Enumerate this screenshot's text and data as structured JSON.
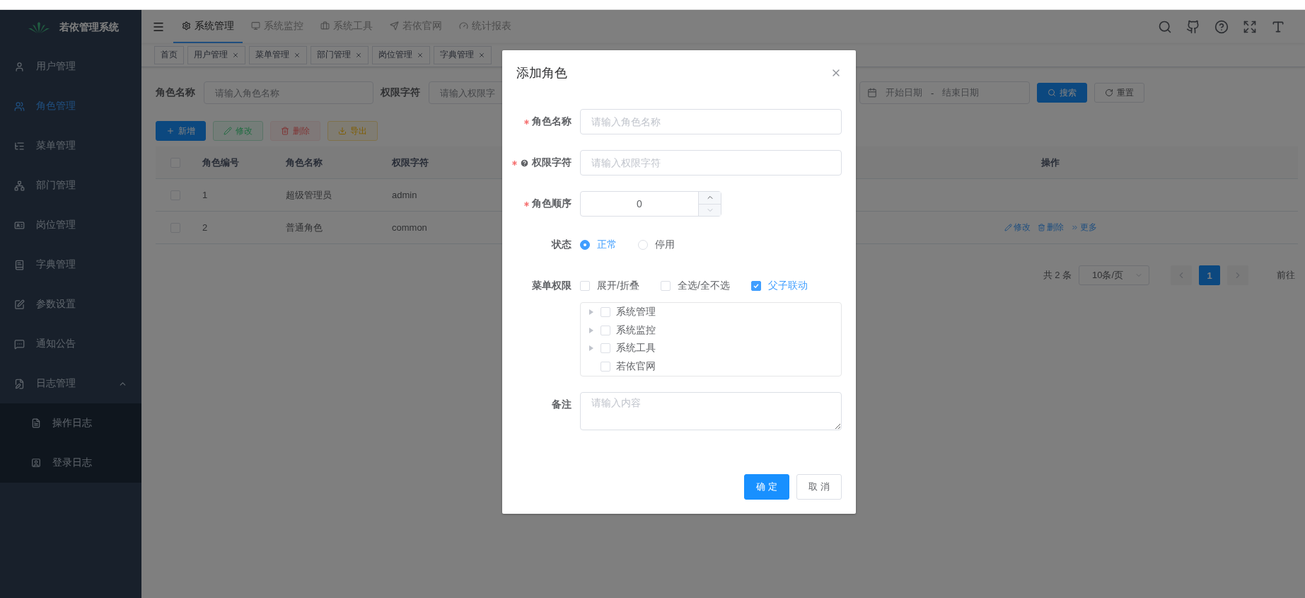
{
  "sidebar": {
    "title": "若依管理系统",
    "items": [
      {
        "label": "用户管理",
        "selected": false
      },
      {
        "label": "角色管理",
        "selected": true
      },
      {
        "label": "菜单管理",
        "selected": false
      },
      {
        "label": "部门管理",
        "selected": false
      },
      {
        "label": "岗位管理",
        "selected": false
      },
      {
        "label": "字典管理",
        "selected": false
      },
      {
        "label": "参数设置",
        "selected": false
      },
      {
        "label": "通知公告",
        "selected": false
      },
      {
        "label": "日志管理",
        "selected": false,
        "expanded": true,
        "children": [
          {
            "label": "操作日志",
            "selected": false
          },
          {
            "label": "登录日志",
            "selected": false
          }
        ]
      }
    ]
  },
  "topnav": {
    "tabs": [
      {
        "label": "系统管理",
        "selected": true
      },
      {
        "label": "系统监控",
        "selected": false
      },
      {
        "label": "系统工具",
        "selected": false
      },
      {
        "label": "若依官网",
        "selected": false
      },
      {
        "label": "统计报表",
        "selected": false
      }
    ]
  },
  "tags": [
    {
      "label": "首页",
      "closable": false
    },
    {
      "label": "用户管理",
      "closable": true
    },
    {
      "label": "菜单管理",
      "closable": true
    },
    {
      "label": "部门管理",
      "closable": true
    },
    {
      "label": "岗位管理",
      "closable": true
    },
    {
      "label": "字典管理",
      "closable": true
    }
  ],
  "search": {
    "fields": [
      {
        "label": "角色名称",
        "placeholder": "请输入角色名称"
      },
      {
        "label": "权限字符",
        "placeholder": "请输入权限字"
      }
    ],
    "date_range": {
      "start": "开始日期",
      "separator": "-",
      "end": "结束日期"
    },
    "buttons": [
      {
        "label": "搜索",
        "kind": "primary"
      },
      {
        "label": "重置",
        "kind": "default"
      }
    ]
  },
  "toolbar": [
    {
      "label": "新增",
      "kind": "primary",
      "disabled": false
    },
    {
      "label": "修改",
      "kind": "success",
      "disabled": true
    },
    {
      "label": "删除",
      "kind": "danger",
      "disabled": true
    },
    {
      "label": "导出",
      "kind": "warning",
      "disabled": false
    }
  ],
  "table": {
    "all_checked": false,
    "columns": [
      "角色编号",
      "角色名称",
      "权限字符"
    ],
    "action_column": "操作",
    "rows": [
      {
        "cells": [
          "1",
          "超级管理员",
          "admin"
        ],
        "checked": false,
        "actions": []
      },
      {
        "cells": [
          "2",
          "普通角色",
          "common"
        ],
        "checked": false,
        "actions": [
          {
            "label": "修改",
            "kind": "edit"
          },
          {
            "label": "删除",
            "kind": "delete"
          },
          {
            "label": "更多",
            "kind": "more"
          }
        ]
      }
    ]
  },
  "pagination": {
    "total": "共 2 条",
    "page_size": "10条/页",
    "pages": [
      {
        "label": "1",
        "selected": true
      }
    ],
    "goto": "前往"
  },
  "dialog": {
    "title": "添加角色",
    "fields": [
      {
        "kind": "text",
        "label": "角色名称",
        "required": true,
        "help": false,
        "placeholder": "请输入角色名称"
      },
      {
        "kind": "text",
        "label": "权限字符",
        "required": true,
        "help": true,
        "placeholder": "请输入权限字符"
      },
      {
        "kind": "number",
        "label": "角色顺序",
        "required": true,
        "help": false,
        "value": "0"
      },
      {
        "kind": "radio",
        "label": "状态",
        "required": false,
        "help": false,
        "options": [
          {
            "label": "正常",
            "selected": true
          },
          {
            "label": "停用",
            "selected": false
          }
        ]
      },
      {
        "kind": "tree",
        "label": "菜单权限",
        "required": false,
        "help": false,
        "options": [
          {
            "label": "展开/折叠",
            "checked": false
          },
          {
            "label": "全选/全不选",
            "checked": false
          },
          {
            "label": "父子联动",
            "checked": true
          }
        ],
        "tree": [
          {
            "label": "系统管理",
            "checked": false,
            "expanded": false
          },
          {
            "label": "系统监控",
            "checked": false,
            "expanded": false
          },
          {
            "label": "系统工具",
            "checked": false,
            "expanded": false
          },
          {
            "label": "若依官网",
            "checked": false
          }
        ]
      },
      {
        "kind": "textarea",
        "label": "备注",
        "required": false,
        "help": false,
        "placeholder": "请输入内容"
      }
    ],
    "buttons": [
      {
        "label": "确 定",
        "kind": "primary"
      },
      {
        "label": "取 消",
        "kind": "default"
      }
    ]
  }
}
